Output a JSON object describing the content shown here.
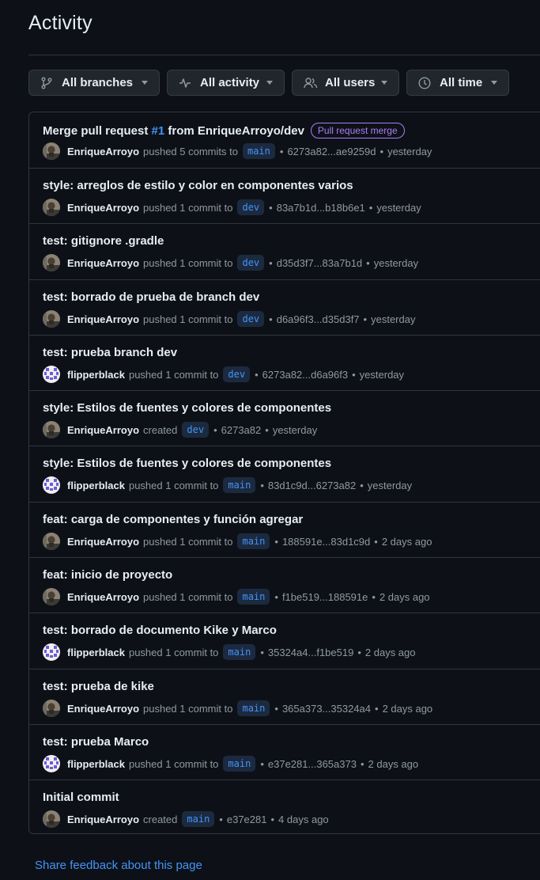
{
  "page": {
    "title": "Activity"
  },
  "filters": [
    {
      "label": "All branches",
      "icon": "branch-icon"
    },
    {
      "label": "All activity",
      "icon": "pulse-icon"
    },
    {
      "label": "All users",
      "icon": "people-icon"
    },
    {
      "label": "All time",
      "icon": "clock-icon"
    }
  ],
  "activity": [
    {
      "message": "Merge pull request ",
      "pr": "#1",
      "message_suffix": " from EnriqueArroyo/dev",
      "badge": "Pull request merge",
      "user": "EnriqueArroyo",
      "avatar": "photo",
      "action": "pushed 5 commits to",
      "branch": "main",
      "commits": "6273a82...ae9259d",
      "time": "yesterday"
    },
    {
      "message": "style: arreglos de estilo y color en componentes varios",
      "user": "EnriqueArroyo",
      "avatar": "photo",
      "action": "pushed 1 commit to",
      "branch": "dev",
      "commits": "83a7b1d...b18b6e1",
      "time": "yesterday"
    },
    {
      "message": "test: gitignore .gradle",
      "user": "EnriqueArroyo",
      "avatar": "photo",
      "action": "pushed 1 commit to",
      "branch": "dev",
      "commits": "d35d3f7...83a7b1d",
      "time": "yesterday"
    },
    {
      "message": "test: borrado de prueba de branch dev",
      "user": "EnriqueArroyo",
      "avatar": "photo",
      "action": "pushed 1 commit to",
      "branch": "dev",
      "commits": "d6a96f3...d35d3f7",
      "time": "yesterday"
    },
    {
      "message": "test: prueba branch dev",
      "user": "flipperblack",
      "avatar": "identicon",
      "action": "pushed 1 commit to",
      "branch": "dev",
      "commits": "6273a82...d6a96f3",
      "time": "yesterday"
    },
    {
      "message": "style: Estilos de fuentes y colores de componentes",
      "user": "EnriqueArroyo",
      "avatar": "photo",
      "action": "created",
      "branch": "dev",
      "commits": "6273a82",
      "time": "yesterday"
    },
    {
      "message": "style: Estilos de fuentes y colores de componentes",
      "user": "flipperblack",
      "avatar": "identicon",
      "action": "pushed 1 commit to",
      "branch": "main",
      "commits": "83d1c9d...6273a82",
      "time": "yesterday"
    },
    {
      "message": "feat: carga de componentes y función agregar",
      "user": "EnriqueArroyo",
      "avatar": "photo",
      "action": "pushed 1 commit to",
      "branch": "main",
      "commits": "188591e...83d1c9d",
      "time": "2 days ago"
    },
    {
      "message": "feat: inicio de proyecto",
      "user": "EnriqueArroyo",
      "avatar": "photo",
      "action": "pushed 1 commit to",
      "branch": "main",
      "commits": "f1be519...188591e",
      "time": "2 days ago"
    },
    {
      "message": "test: borrado de documento Kike y Marco",
      "user": "flipperblack",
      "avatar": "identicon",
      "action": "pushed 1 commit to",
      "branch": "main",
      "commits": "35324a4...f1be519",
      "time": "2 days ago"
    },
    {
      "message": "test: prueba de kike",
      "user": "EnriqueArroyo",
      "avatar": "photo",
      "action": "pushed 1 commit to",
      "branch": "main",
      "commits": "365a373...35324a4",
      "time": "2 days ago"
    },
    {
      "message": "test: prueba Marco",
      "user": "flipperblack",
      "avatar": "identicon",
      "action": "pushed 1 commit to",
      "branch": "main",
      "commits": "e37e281...365a373",
      "time": "2 days ago"
    },
    {
      "message": "Initial commit",
      "user": "EnriqueArroyo",
      "avatar": "photo",
      "action": "created",
      "branch": "main",
      "commits": "e37e281",
      "time": "4 days ago"
    }
  ],
  "footer": {
    "feedback_link": "Share feedback about this page"
  },
  "colors": {
    "background": "#0d1117",
    "link": "#4493f8",
    "badge": "#ab7df8",
    "border": "#30363d"
  }
}
